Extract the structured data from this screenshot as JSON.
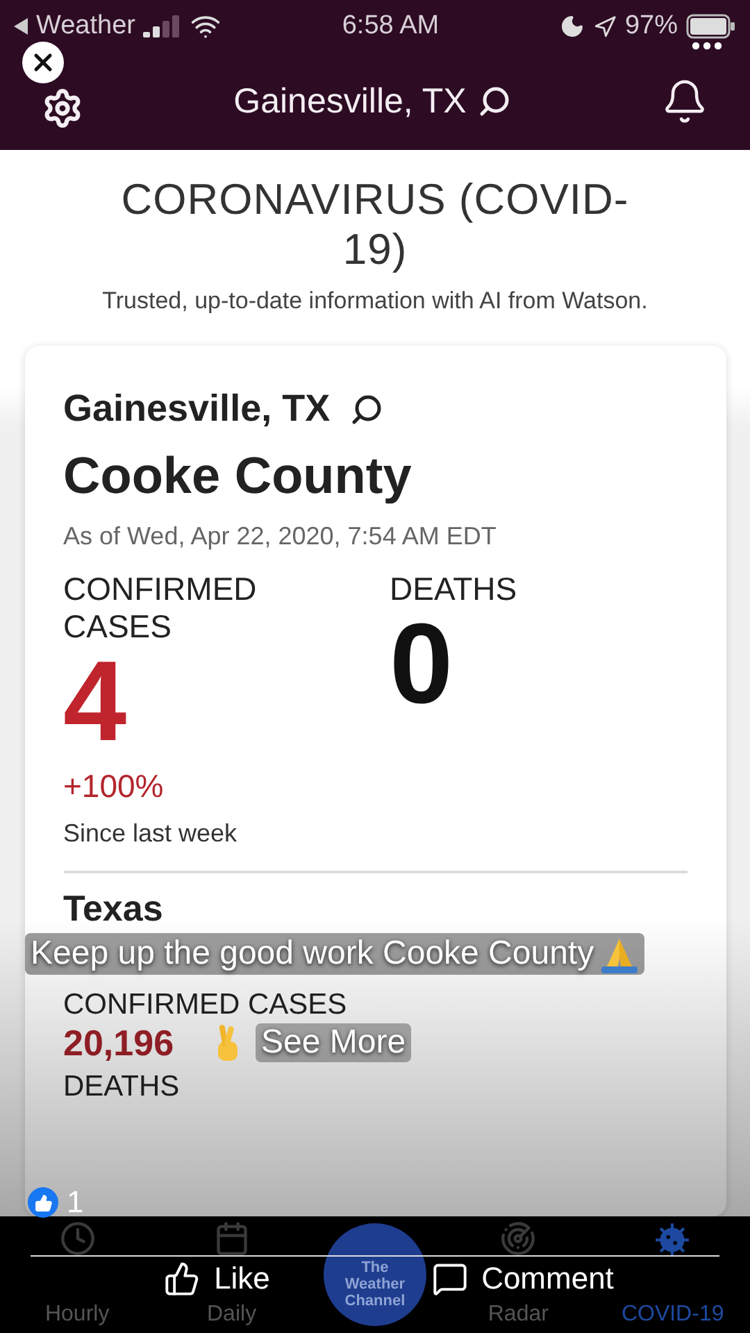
{
  "status_bar": {
    "back_label": "Weather",
    "time": "6:58 AM",
    "battery": "97%"
  },
  "header": {
    "location": "Gainesville, TX"
  },
  "intro": {
    "title": "CORONAVIRUS (COVID-19)",
    "subtitle": "Trusted, up-to-date information with AI from Watson."
  },
  "local_card": {
    "location": "Gainesville, TX",
    "county": "Cooke County",
    "as_of": "As of Wed, Apr 22, 2020, 7:54 AM EDT",
    "stats": [
      {
        "label": "CONFIRMED CASES",
        "value": "4",
        "change": "+100%",
        "change_note": "Since last week"
      },
      {
        "label": "DEATHS",
        "value": "0"
      }
    ],
    "state_section": {
      "name": "Texas",
      "stats": [
        {
          "label": "CONFIRMED CASES",
          "value": "20,196"
        },
        {
          "label": "DEATHS"
        }
      ]
    }
  },
  "tab_bar": [
    {
      "label": "Hourly",
      "kind": "tab",
      "selected": false
    },
    {
      "label": "Daily",
      "kind": "tab",
      "selected": false
    },
    {
      "label": "The Weather Channel",
      "kind": "logo",
      "selected": false
    },
    {
      "label": "Radar",
      "kind": "tab",
      "selected": false
    },
    {
      "label": "COVID-19",
      "kind": "tab",
      "selected": true
    }
  ],
  "post_overlay": {
    "caption": "Keep up the good work Cooke County",
    "see_more": "See More",
    "like_count": "1",
    "actions": [
      "Like",
      "Comment"
    ]
  }
}
